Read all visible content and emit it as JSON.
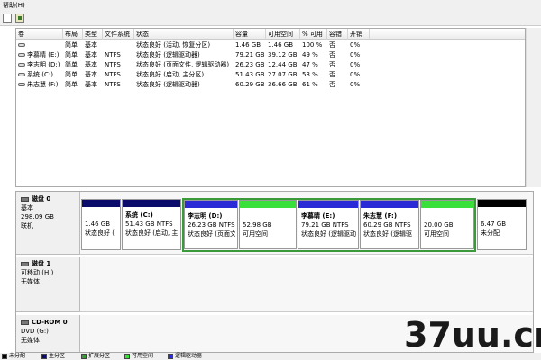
{
  "menu": {
    "help": "帮助(H)"
  },
  "table": {
    "columns": [
      "卷",
      "布局",
      "类型",
      "文件系统",
      "状态",
      "容量",
      "可用空间",
      "% 可用",
      "容错",
      "开销"
    ],
    "rows": [
      [
        "",
        "简单",
        "基本",
        "",
        "状态良好 (活动, 恢复分区)",
        "1.46 GB",
        "1.46 GB",
        "100 %",
        "否",
        "0%"
      ],
      [
        "李慕晴 (E:)",
        "简单",
        "基本",
        "NTFS",
        "状态良好 (逻辑驱动器)",
        "79.21 GB",
        "39.12 GB",
        "49 %",
        "否",
        "0%"
      ],
      [
        "李志明 (D:)",
        "简单",
        "基本",
        "NTFS",
        "状态良好 (页面文件, 逻辑驱动器)",
        "26.23 GB",
        "12.44 GB",
        "47 %",
        "否",
        "0%"
      ],
      [
        "系统 (C:)",
        "简单",
        "基本",
        "NTFS",
        "状态良好 (启动, 主分区)",
        "51.43 GB",
        "27.07 GB",
        "53 %",
        "否",
        "0%"
      ],
      [
        "朱志慧 (F:)",
        "简单",
        "基本",
        "NTFS",
        "状态良好 (逻辑驱动器)",
        "60.29 GB",
        "36.66 GB",
        "61 %",
        "否",
        "0%"
      ]
    ]
  },
  "disks": [
    {
      "name": "磁盘 0",
      "lines": [
        "基本",
        "298.09 GB",
        "联机"
      ]
    },
    {
      "name": "磁盘 1",
      "lines": [
        "可移动 (H:)",
        "",
        "无媒体"
      ]
    },
    {
      "name": "CD-ROM 0",
      "lines": [
        "DVD (G:)",
        "",
        "无媒体"
      ]
    }
  ],
  "partitions": [
    {
      "title": "",
      "size": "1.46 GB",
      "status": "状态良好 (",
      "color": "#0a0a6a"
    },
    {
      "title": "系统 (C:)",
      "size": "51.43 GB NTFS",
      "status": "状态良好 (启动, 主",
      "color": "#0a0a6a"
    },
    {
      "title": "李志明 (D:)",
      "size": "26.23 GB NTFS",
      "status": "状态良好 (页面文",
      "color": "#2a2ad6"
    },
    {
      "title": "",
      "size": "52.98 GB",
      "status": "可用空间",
      "color": "#3ae03a"
    },
    {
      "title": "李慕晴 (E:)",
      "size": "79.21 GB NTFS",
      "status": "状态良好 (逻辑驱动",
      "color": "#2a2ad6"
    },
    {
      "title": "朱志慧 (F:)",
      "size": "60.29 GB NTFS",
      "status": "状态良好 (逻辑驱",
      "color": "#2a2ad6"
    },
    {
      "title": "",
      "size": "20.00 GB",
      "status": "可用空间",
      "color": "#3ae03a"
    },
    {
      "title": "",
      "size": "6.47 GB",
      "status": "未分配",
      "color": "#000000"
    }
  ],
  "legend": [
    {
      "label": "未分配",
      "color": "#000000"
    },
    {
      "label": "主分区",
      "color": "#0a0a6a"
    },
    {
      "label": "扩展分区",
      "color": "#3a9a3a"
    },
    {
      "label": "可用空间",
      "color": "#3ae03a"
    },
    {
      "label": "逻辑驱动器",
      "color": "#2a2ad6"
    }
  ],
  "watermark": {
    "text": "37uu.cn"
  }
}
